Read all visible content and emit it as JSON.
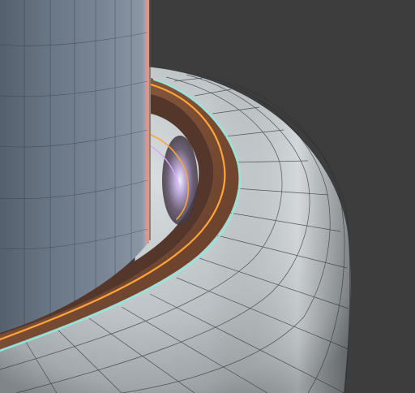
{
  "viewport": {
    "background": "#3d3d3d",
    "kind": "3d-viewport-closeup"
  },
  "scene": {
    "colors": {
      "background": "#3d3d3d",
      "inner_cylinder_dark": "#47505c",
      "inner_cylinder_mid": "#6c7887",
      "inner_cylinder_light": "#8e99a6",
      "outer_body_light": "#d7dde0",
      "outer_body_mid": "#aeb5b9",
      "outer_body_shadow": "#7d8286",
      "wireframe": "#2b2f33",
      "rim_copper": "#8b5a3c",
      "rim_copper_dark": "#4f3326",
      "selection_orange": "#ffa43a",
      "active_edge_cyan": "#8fe8d8",
      "highlight_pink": "#d8a4ff",
      "cylinder_edge_salmon": "#d89a86"
    },
    "objects": [
      {
        "name": "inner-cylinder",
        "type": "mesh"
      },
      {
        "name": "outer-torus-body",
        "type": "mesh"
      },
      {
        "name": "copper-rim",
        "type": "mesh"
      },
      {
        "name": "selected-edge-loop",
        "type": "selection"
      }
    ]
  }
}
